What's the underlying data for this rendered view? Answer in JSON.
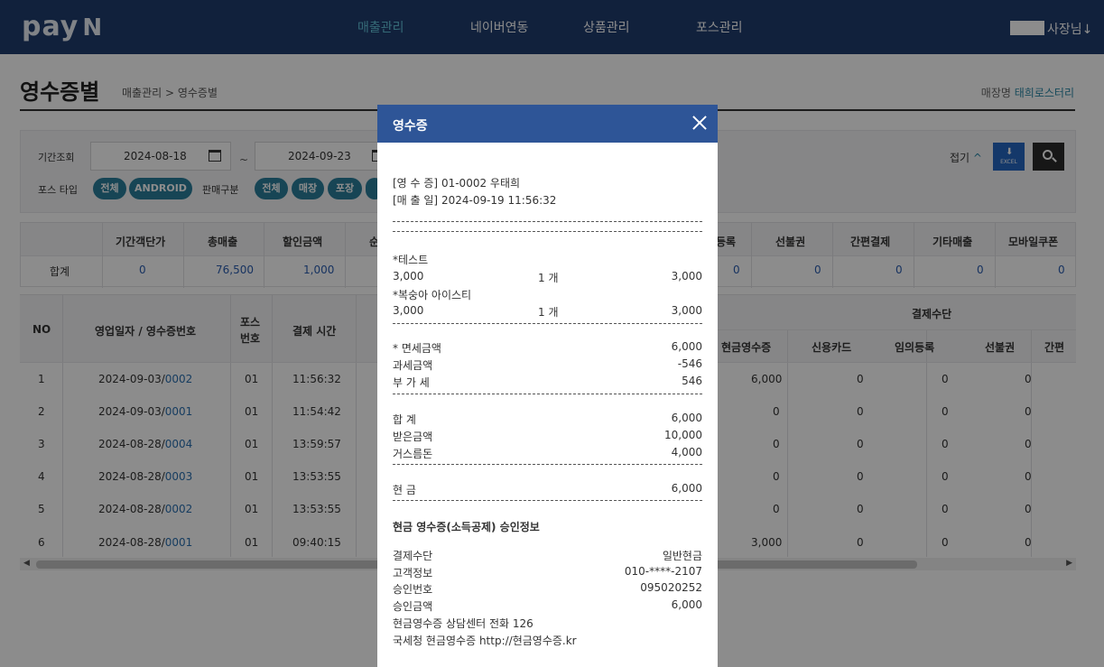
{
  "app": {
    "logo": "pay",
    "logo_suffix": "N",
    "nav": [
      {
        "label": "매출관리",
        "active": true
      },
      {
        "label": "네이버연동",
        "active": false
      },
      {
        "label": "상품관리",
        "active": false
      },
      {
        "label": "포스관리",
        "active": false
      }
    ],
    "user_label": "사장님",
    "user_arrow": "↓"
  },
  "page": {
    "title": "영수증별",
    "breadcrumb": "매출관리 > 영수증별",
    "store_label": "매장명",
    "store_name": "태희로스터리"
  },
  "filter": {
    "period_label": "기간조회",
    "start_date": "2024-08-18",
    "end_date": "2024-09-23",
    "tilde": "~",
    "pos_type_label": "포스 타입",
    "pos_types": [
      "전체",
      "ANDROID"
    ],
    "sales_type_label": "판매구분",
    "sales_types": [
      "전체",
      "매장",
      "포장"
    ],
    "fold_label": "접기",
    "fold_icon": "^",
    "excel_label": "EXCEL"
  },
  "summary": {
    "headers": [
      "기간객단가",
      "총매출",
      "할인금액",
      "순",
      "등록",
      "선불권",
      "간편결제",
      "기타매출",
      "모바일쿠폰"
    ],
    "row_label": "합계",
    "values": [
      "0",
      "76,500",
      "1,000",
      "0",
      "0",
      "0",
      "0",
      "0"
    ]
  },
  "table": {
    "headers_left": [
      "NO",
      "영업일자 / 영수증번호",
      "포스\n번호",
      "결제 시간"
    ],
    "group_header": "결제수단",
    "headers_right": [
      "현금영수증",
      "신용카드",
      "임의등록",
      "선불권",
      "간편"
    ],
    "rows": [
      {
        "no": "1",
        "date": "2024-09-03/",
        "receipt": "0002",
        "pos": "01",
        "time": "11:56:32",
        "cash_receipt": "6,000",
        "card": "0",
        "manual": "0",
        "prepaid": "0"
      },
      {
        "no": "2",
        "date": "2024-09-03/",
        "receipt": "0001",
        "pos": "01",
        "time": "11:54:42",
        "cash_receipt": "0",
        "card": "0",
        "manual": "0",
        "prepaid": "0"
      },
      {
        "no": "3",
        "date": "2024-08-28/",
        "receipt": "0004",
        "pos": "01",
        "time": "13:59:57",
        "cash_receipt": "0",
        "card": "0",
        "manual": "0",
        "prepaid": "0"
      },
      {
        "no": "4",
        "date": "2024-08-28/",
        "receipt": "0003",
        "pos": "01",
        "time": "13:53:55",
        "cash_receipt": "0",
        "card": "0",
        "manual": "0",
        "prepaid": "0"
      },
      {
        "no": "5",
        "date": "2024-08-28/",
        "receipt": "0002",
        "pos": "01",
        "time": "13:53:55",
        "cash_receipt": "0",
        "card": "0",
        "manual": "0",
        "prepaid": "0"
      },
      {
        "no": "6",
        "date": "2024-08-28/",
        "receipt": "0001",
        "pos": "01",
        "time": "09:40:15",
        "cash_receipt": "3,000",
        "card": "0",
        "manual": "0",
        "prepaid": "0"
      }
    ]
  },
  "modal": {
    "title": "영수증",
    "receipt_no_label": "[영 수 증]",
    "receipt_no": "01-0002 우태희",
    "sale_date_label": "[매 출 일]",
    "sale_date": "2024-09-19 11:56:32",
    "items": [
      {
        "name": "*테스트",
        "price": "3,000",
        "qty": "1 개",
        "amount": "3,000"
      },
      {
        "name": "*복숭아 아이스티",
        "price": "3,000",
        "qty": "1 개",
        "amount": "3,000"
      }
    ],
    "tax": [
      {
        "label": "* 면세금액",
        "value": "6,000"
      },
      {
        "label": "과세금액",
        "value": "-546"
      },
      {
        "label": "부 가 세",
        "value": "546"
      }
    ],
    "totals": [
      {
        "label": "합 계",
        "value": "6,000"
      },
      {
        "label": "받은금액",
        "value": "10,000"
      },
      {
        "label": "거스름돈",
        "value": "4,000"
      }
    ],
    "cash": {
      "label": "현 금",
      "value": "6,000"
    },
    "approval_title": "현금 영수증(소득공제) 승인정보",
    "approval": [
      {
        "label": "결제수단",
        "value": "일반현금"
      },
      {
        "label": "고객정보",
        "value": "010-****-2107"
      },
      {
        "label": "승인번호",
        "value": "095020252"
      },
      {
        "label": "승인금액",
        "value": "6,000"
      }
    ],
    "footer": [
      "현금영수증 상담센터 전화 126",
      "국세청 현금영수증 http://현금영수증.kr"
    ]
  }
}
